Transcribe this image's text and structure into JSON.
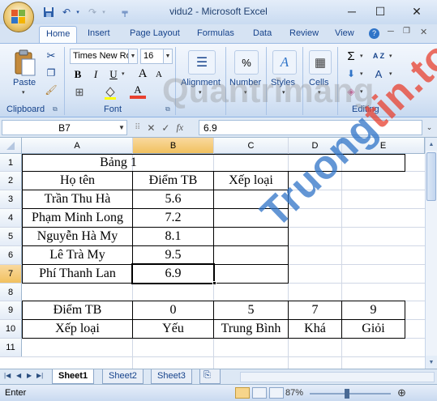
{
  "window": {
    "title": "vidu2 - Microsoft Excel",
    "minimize": "─",
    "maximize": "☐",
    "close": "✕",
    "qat_more": "╤"
  },
  "ribbon_tabs": [
    "Home",
    "Insert",
    "Page Layout",
    "Formulas",
    "Data",
    "Review",
    "View"
  ],
  "ribbon": {
    "clipboard": {
      "paste_label": "Paste",
      "group_label": "Clipboard"
    },
    "font": {
      "font_name": "Times New Ro",
      "font_size": "16",
      "bold": "B",
      "italic": "I",
      "underline": "U",
      "grow": "A",
      "shrink": "A",
      "font_color": "A",
      "group_label": "Font"
    },
    "alignment_label": "Alignment",
    "number_label": "Number",
    "number_symbol": "%",
    "styles_label": "Styles",
    "styles_symbol": "A",
    "cells_label": "Cells",
    "editing": {
      "sum": "Σ",
      "sort": "A Z",
      "find": "A",
      "group_label": "Editing"
    }
  },
  "formula_bar": {
    "cell_ref": "B7",
    "fx": "fx",
    "value": "6.9"
  },
  "columns": [
    "A",
    "B",
    "C",
    "D",
    "E"
  ],
  "rows": [
    "1",
    "2",
    "3",
    "4",
    "5",
    "6",
    "7",
    "8",
    "9",
    "10",
    "11"
  ],
  "table": {
    "title": "Bảng 1",
    "headers": [
      "Họ tên",
      "Điểm TB",
      "Xếp loại"
    ],
    "records": [
      [
        "Trần Thu Hà",
        "5.6",
        ""
      ],
      [
        "Phạm Minh Long",
        "7.2",
        ""
      ],
      [
        "Nguyễn Hà My",
        "8.1",
        ""
      ],
      [
        "Lê Trà My",
        "9.5",
        ""
      ],
      [
        "Phí Thanh Lan",
        "6.9",
        ""
      ]
    ]
  },
  "lookup": {
    "row_label_1": "Điểm TB",
    "thresholds": [
      "0",
      "5",
      "7",
      "9"
    ],
    "row_label_2": "Xếp loại",
    "grades": [
      "Yếu",
      "Trung Bình",
      "Khá",
      "Giỏi"
    ]
  },
  "sheets": [
    "Sheet1",
    "Sheet2",
    "Sheet3"
  ],
  "active_sheet": "Sheet1",
  "status": {
    "mode": "Enter",
    "zoom": "87%"
  },
  "watermark": {
    "small": "Quantrimang",
    "big_a": "Truong",
    "big_b": "tin.top"
  },
  "colors": {
    "ribbon_bg": "#dbe7f6",
    "selected_header": "#f1c15f",
    "watermark_blue": "#2f74c8",
    "watermark_red": "#e8402f"
  }
}
